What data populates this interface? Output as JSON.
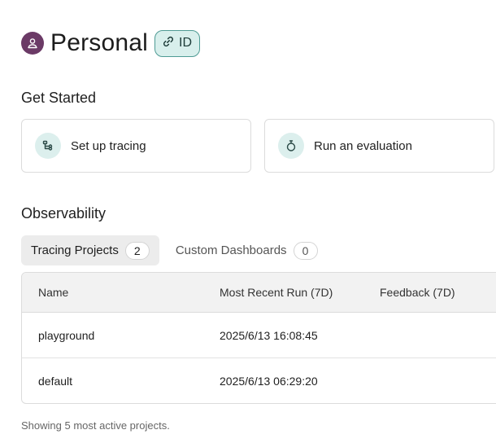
{
  "header": {
    "workspace_name": "Personal",
    "id_badge_label": "ID",
    "avatar_icon": "user-icon",
    "accent_color": "#6b3a66"
  },
  "get_started": {
    "title": "Get Started",
    "cards": [
      {
        "label": "Set up tracing",
        "icon": "tracing-icon"
      },
      {
        "label": "Run an evaluation",
        "icon": "stopwatch-icon"
      }
    ]
  },
  "observability": {
    "title": "Observability",
    "tabs": [
      {
        "label": "Tracing Projects",
        "count": "2",
        "active": true
      },
      {
        "label": "Custom Dashboards",
        "count": "0",
        "active": false
      }
    ],
    "table": {
      "columns": [
        "Name",
        "Most Recent Run (7D)",
        "Feedback (7D)"
      ],
      "rows": [
        {
          "name": "playground",
          "recent_run": "2025/6/13 16:08:45",
          "feedback": ""
        },
        {
          "name": "default",
          "recent_run": "2025/6/13 06:29:20",
          "feedback": ""
        }
      ]
    },
    "footer_text": "Showing 5 most active projects."
  }
}
